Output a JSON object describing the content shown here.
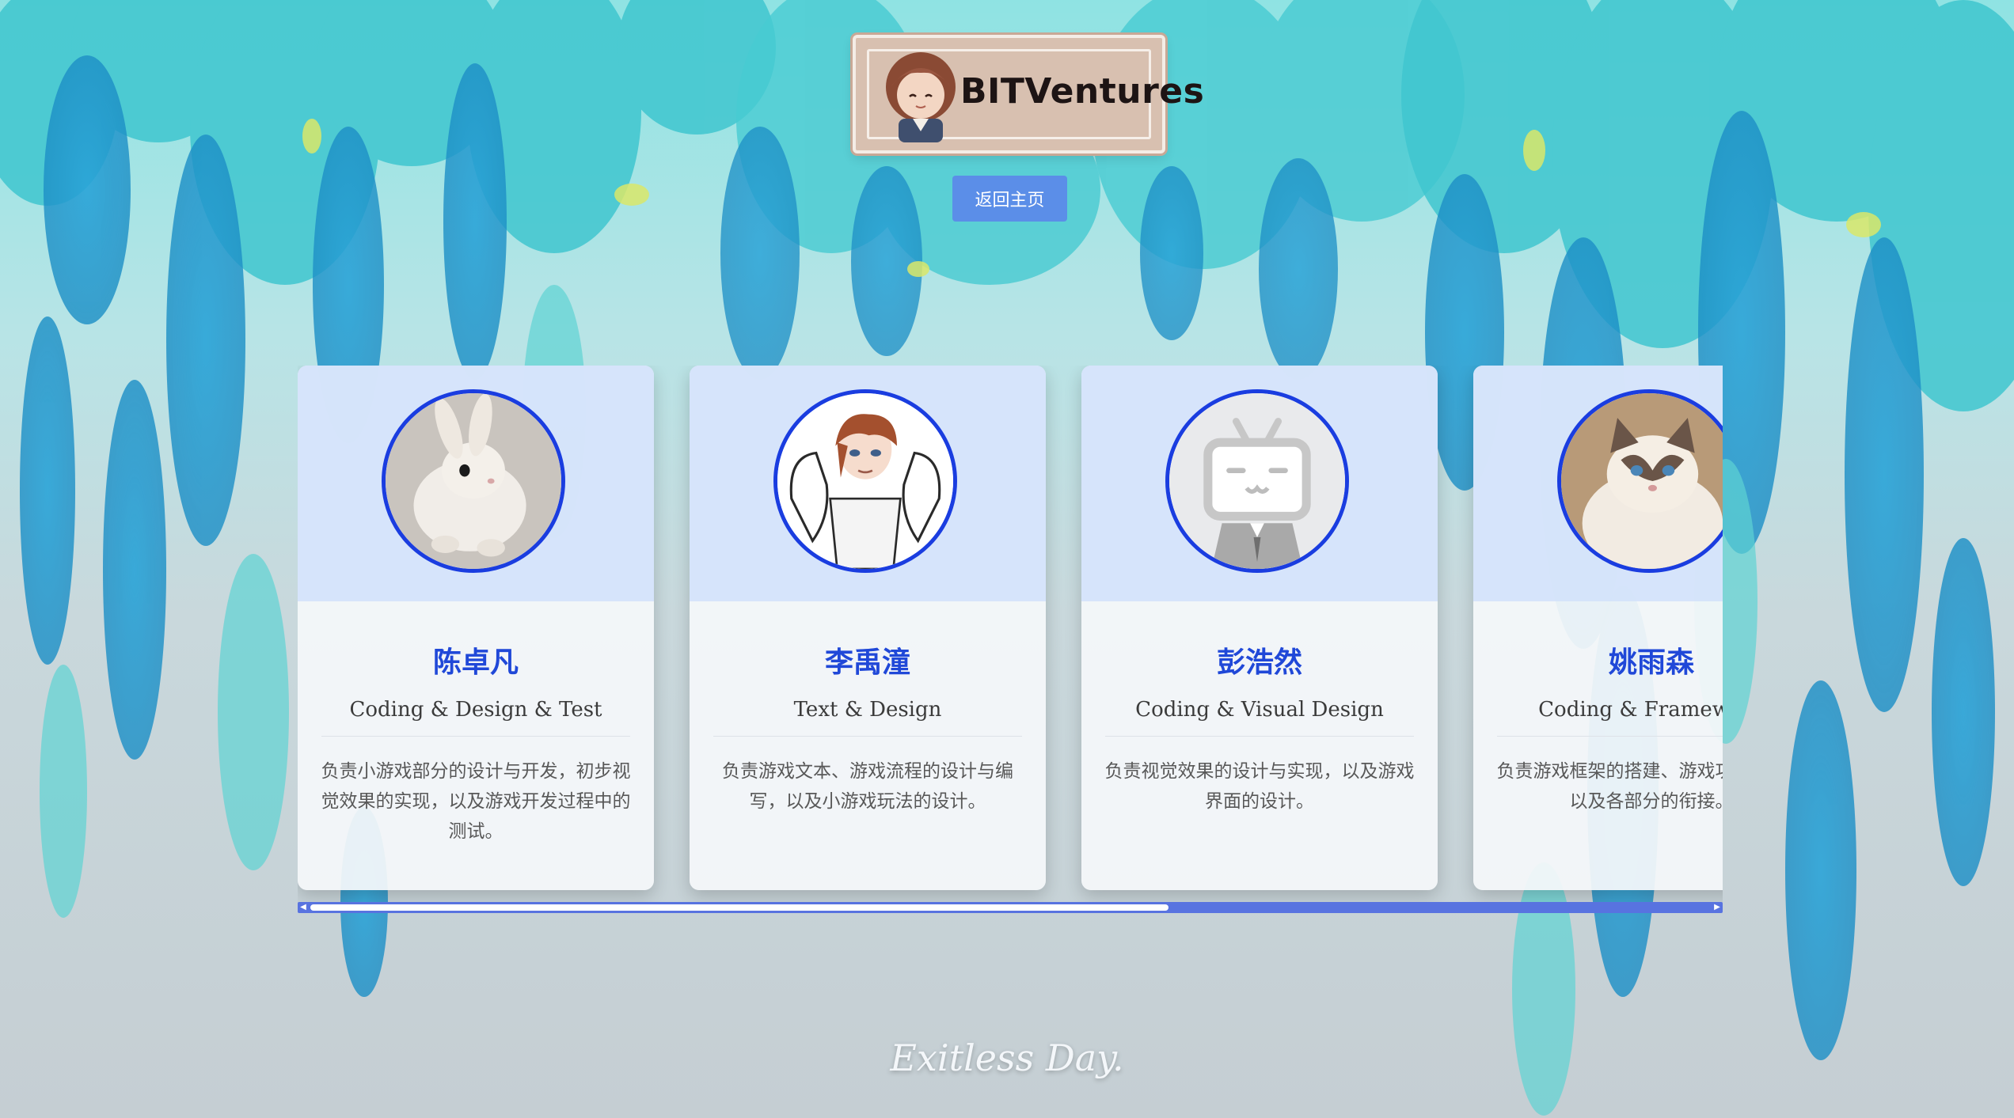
{
  "logo": {
    "text": "BITVentures"
  },
  "nav": {
    "home_label": "返回主页"
  },
  "members": [
    {
      "name": "陈卓凡",
      "role": "Coding & Design & Test",
      "desc": "负责小游戏部分的设计与开发，初步视觉效果的实现，以及游戏开发过程中的测试。",
      "avatar_icon": "rabbit-icon"
    },
    {
      "name": "李禹潼",
      "role": "Text & Design",
      "desc": "负责游戏文本、游戏流程的设计与编写，以及小游戏玩法的设计。",
      "avatar_icon": "anime-character-icon"
    },
    {
      "name": "彭浩然",
      "role": "Coding & Visual Design",
      "desc": "负责视觉效果的设计与实现，以及游戏界面的设计。",
      "avatar_icon": "tv-mascot-icon"
    },
    {
      "name": "姚雨森",
      "role": "Coding & Framework",
      "desc": "负责游戏框架的搭建、游戏功能的实现以及各部分的衔接。",
      "avatar_icon": "cat-icon"
    }
  ],
  "scroll": {
    "position": 0.61
  },
  "footer": {
    "tagline": "Exitless Day."
  },
  "colors": {
    "accent": "#1a3de0",
    "name_text": "#2048d8",
    "button_bg": "#5b8ee8",
    "scrollbar": "#5873e0"
  }
}
